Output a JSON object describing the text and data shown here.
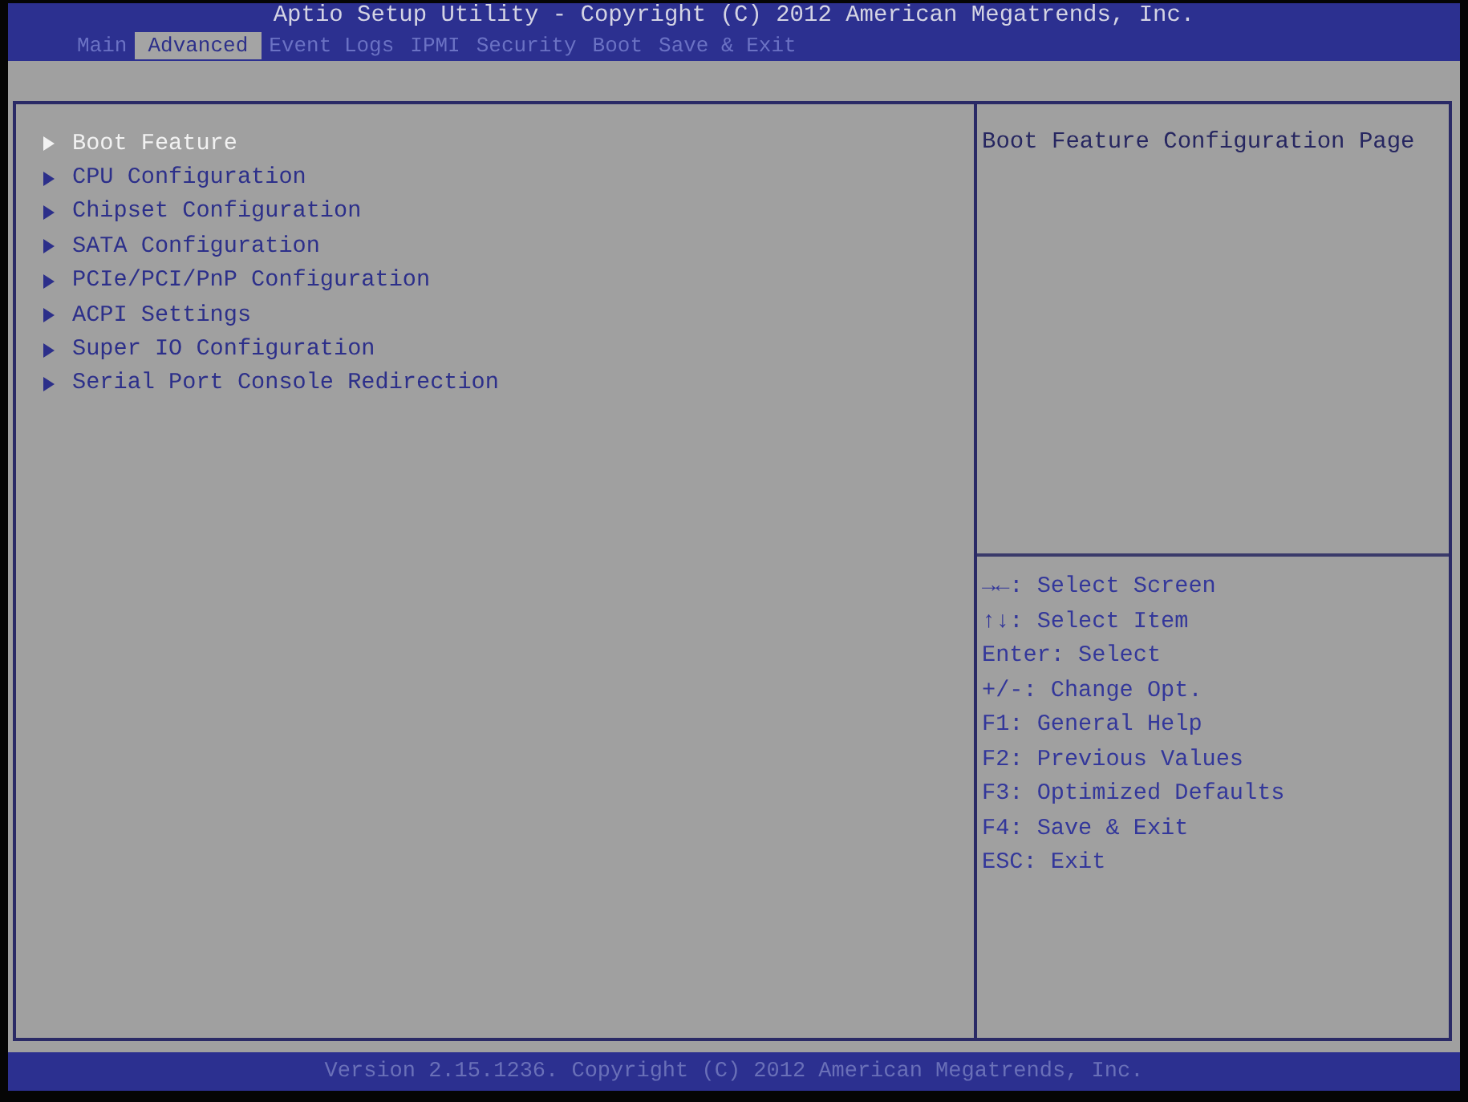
{
  "window": {
    "title": "Aptio Setup Utility - Copyright (C) 2012 American Megatrends, Inc."
  },
  "tabs": [
    {
      "label": "Main",
      "selected": false
    },
    {
      "label": "Advanced",
      "selected": true
    },
    {
      "label": "Event Logs",
      "selected": false
    },
    {
      "label": "IPMI",
      "selected": false
    },
    {
      "label": "Security",
      "selected": false
    },
    {
      "label": "Boot",
      "selected": false
    },
    {
      "label": "Save & Exit",
      "selected": false
    }
  ],
  "menu": {
    "items": [
      {
        "label": "Boot Feature",
        "selected": true
      },
      {
        "label": "CPU Configuration",
        "selected": false
      },
      {
        "label": "Chipset Configuration",
        "selected": false
      },
      {
        "label": "SATA Configuration",
        "selected": false
      },
      {
        "label": "PCIe/PCI/PnP Configuration",
        "selected": false
      },
      {
        "label": "ACPI Settings",
        "selected": false
      },
      {
        "label": "Super IO Configuration",
        "selected": false
      },
      {
        "label": "Serial Port Console Redirection",
        "selected": false
      }
    ]
  },
  "help": {
    "description": "Boot Feature Configuration Page",
    "keys": [
      "→←: Select Screen",
      "↑↓: Select Item",
      "Enter: Select",
      "+/-: Change Opt.",
      "F1: General Help",
      "F2: Previous Values",
      "F3: Optimized Defaults",
      "F4: Save & Exit",
      "ESC: Exit"
    ]
  },
  "status_bar": {
    "text": "Version 2.15.1236. Copyright (C) 2012 American Megatrends, Inc."
  }
}
